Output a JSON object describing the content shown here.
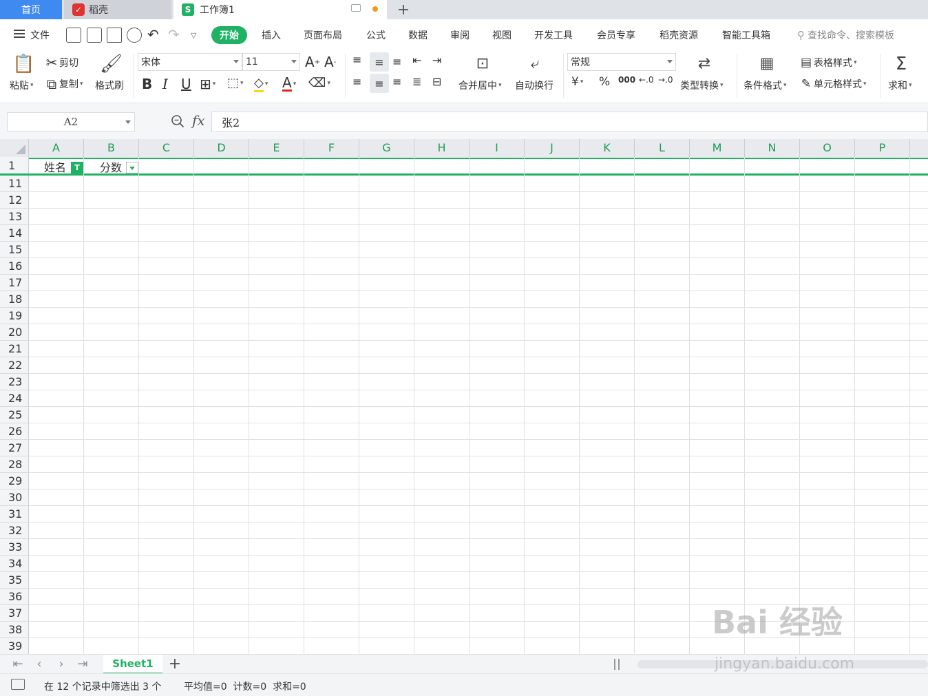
{
  "tabs": {
    "home": "首页",
    "docer": "稻壳",
    "workbook": "工作簿1",
    "add": "+"
  },
  "menu": {
    "file": "文件",
    "items": [
      "开始",
      "插入",
      "页面布局",
      "公式",
      "数据",
      "审阅",
      "视图",
      "开发工具",
      "会员专享",
      "稻壳资源",
      "智能工具箱"
    ],
    "active_index": 0,
    "search": "查找命令、搜索模板"
  },
  "ribbon": {
    "paste": "粘贴",
    "cut": "剪切",
    "copy": "复制",
    "format_painter": "格式刷",
    "font_name": "宋体",
    "font_size": "11",
    "merge_center": "合并居中",
    "wrap_text": "自动换行",
    "number_format": "常规",
    "type_convert": "类型转换",
    "conditional_format": "条件格式",
    "table_style": "表格样式",
    "cell_style": "单元格样式",
    "sum": "求和",
    "bold": "B",
    "italic": "I",
    "underline": "U",
    "font_color_letter": "A",
    "currency": "¥",
    "percent": "%",
    "thousands": "000"
  },
  "formula_bar": {
    "name_box": "A2",
    "fx": "fx",
    "value": "张2"
  },
  "grid": {
    "columns": [
      "A",
      "B",
      "C",
      "D",
      "E",
      "F",
      "G",
      "H",
      "I",
      "J",
      "K",
      "L",
      "M",
      "N",
      "O",
      "P"
    ],
    "header_row": "1",
    "header_cells": [
      "姓名",
      "分数"
    ],
    "visible_rows": [
      "11",
      "12",
      "13",
      "14",
      "15",
      "16",
      "17",
      "18",
      "19",
      "20",
      "21",
      "22",
      "23",
      "24",
      "25",
      "26",
      "27",
      "28",
      "29",
      "30",
      "31",
      "32",
      "33",
      "34",
      "35",
      "36",
      "37",
      "38",
      "39"
    ]
  },
  "sheets": {
    "tabs": [
      "Sheet1"
    ],
    "active": "Sheet1"
  },
  "status": {
    "filter_info": "在 12 个记录中筛选出 3 个",
    "stats": "平均值=0  计数=0  求和=0"
  },
  "watermark": {
    "logo": "Bai 经验",
    "url": "jingyan.baidu.com"
  },
  "colors": {
    "accent": "#1fb264",
    "home_tab": "#3f8af1",
    "docer": "#e0322e"
  }
}
